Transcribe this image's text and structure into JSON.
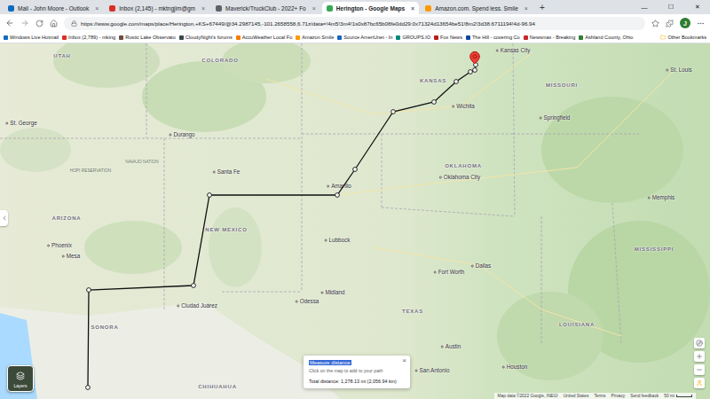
{
  "browser": {
    "tabs": [
      {
        "label": "Mail - John Moore - Outlook",
        "close": "×",
        "selected": false
      },
      {
        "label": "Inbox (2,145) - mktngjim@gm",
        "close": "×",
        "selected": false
      },
      {
        "label": "Maverick/TruckClub - 2022+ Fo",
        "close": "×",
        "selected": false
      },
      {
        "label": "Herington - Google Maps",
        "close": "×",
        "selected": true
      },
      {
        "label": "Amazon.com. Spend less. Smile",
        "close": "×",
        "selected": false
      }
    ],
    "new_tab": "+",
    "window_controls": [
      "—",
      "☐",
      "✕"
    ]
  },
  "address_bar": {
    "url": "https://www.google.com/maps/place/Herington,+KS+67449/@34.2987145,-101.2658558,6.71z/data=!4m5!3m4!1s0x87bc65b08fe0dd29:0x71324d13654be51!8m2!3d38.6711194!4d-96.94"
  },
  "profile": {
    "initial": "J"
  },
  "bookmarks": [
    "Windows Live Hotmail",
    "Inbox (2,789) - mktng",
    "Rustic Lake Observato",
    "CloudyNight's forums",
    "AccuWeather Local Fo",
    "Amazon Smile",
    "Source AmeriUnet - In",
    "GROUPS.IO",
    "Fox News",
    "The Hill - covering Co",
    "Newsmax - Breaking",
    "Ashland County, Ohio"
  ],
  "other_bookmarks": "Other Bookmarks",
  "map": {
    "labels": [
      {
        "text": "UTAH",
        "kind": "state"
      },
      {
        "text": "COLORADO",
        "kind": "state"
      },
      {
        "text": "Kansas City",
        "kind": "city"
      },
      {
        "text": "St. Louis",
        "kind": "city"
      },
      {
        "text": "KANSAS",
        "kind": "state"
      },
      {
        "text": "MISSOURI",
        "kind": "state"
      },
      {
        "text": "Wichita",
        "kind": "city"
      },
      {
        "text": "Springfield",
        "kind": "city"
      },
      {
        "text": "St. George",
        "kind": "city"
      },
      {
        "text": "Durango",
        "kind": "city"
      },
      {
        "text": "Santa Fe",
        "kind": "city"
      },
      {
        "text": "OKLAHOMA",
        "kind": "state"
      },
      {
        "text": "Oklahoma City",
        "kind": "city"
      },
      {
        "text": "Amarillo",
        "kind": "city"
      },
      {
        "text": "Memphis",
        "kind": "city"
      },
      {
        "text": "ARIZONA",
        "kind": "state"
      },
      {
        "text": "NEW MEXICO",
        "kind": "state"
      },
      {
        "text": "Lubbock",
        "kind": "city"
      },
      {
        "text": "Phoenix",
        "kind": "city"
      },
      {
        "text": "Mesa",
        "kind": "city"
      },
      {
        "text": "MISSISSIPPI",
        "kind": "state"
      },
      {
        "text": "Dallas",
        "kind": "city"
      },
      {
        "text": "Fort Worth",
        "kind": "city"
      },
      {
        "text": "Midland",
        "kind": "city"
      },
      {
        "text": "Odessa",
        "kind": "city"
      },
      {
        "text": "Ciudad Juárez",
        "kind": "city"
      },
      {
        "text": "TEXAS",
        "kind": "state"
      },
      {
        "text": "SONORA",
        "kind": "state"
      },
      {
        "text": "LOUISIANA",
        "kind": "state"
      },
      {
        "text": "Austin",
        "kind": "city"
      },
      {
        "text": "Houston",
        "kind": "city"
      },
      {
        "text": "San Antonio",
        "kind": "city"
      },
      {
        "text": "CHIHUAHUA",
        "kind": "state"
      },
      {
        "text": "NAVAJO NATION",
        "kind": "region"
      },
      {
        "text": "HOPI RESERVATION",
        "kind": "region"
      }
    ]
  },
  "measure": {
    "title": "Measure distance",
    "hint": "Click on the map to add to your path",
    "total": "Total distance: 1,278.13 mi (2,056.94 km)",
    "close": "×"
  },
  "layers": "Layers",
  "footer": [
    "Map data ©2022 Google, INEGI",
    "United States",
    "Terms",
    "Privacy",
    "Send feedback"
  ],
  "scale": "50 mi"
}
